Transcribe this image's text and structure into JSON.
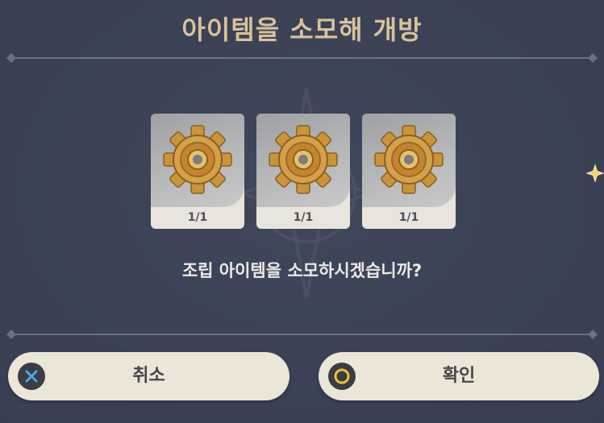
{
  "dialog": {
    "title": "아이템을 소모해 개방",
    "question": "조립 아이템을 소모하시겠습니까?"
  },
  "items": [
    {
      "icon": "gear-icon",
      "count": "1/1"
    },
    {
      "icon": "gear-icon",
      "count": "1/1"
    },
    {
      "icon": "gear-icon",
      "count": "1/1"
    }
  ],
  "buttons": {
    "cancel": {
      "label": "취소",
      "icon": "x-button-icon",
      "icon_color": "#4aa8e8"
    },
    "confirm": {
      "label": "확인",
      "icon": "circle-button-icon",
      "icon_color": "#f2c230"
    }
  },
  "colors": {
    "background": "#3b4256",
    "title": "#d9c29a",
    "button": "#ece6d9"
  }
}
